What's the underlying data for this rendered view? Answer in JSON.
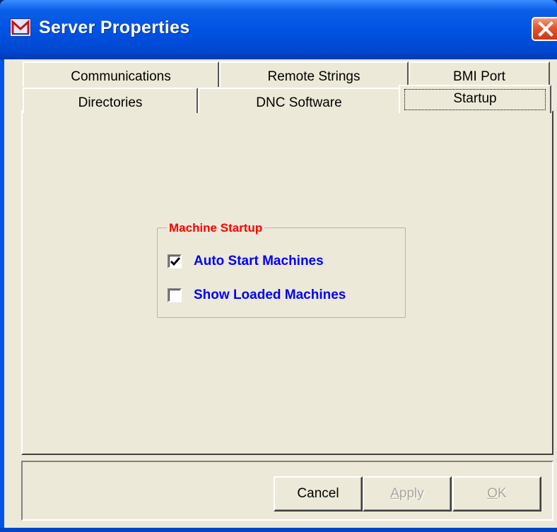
{
  "window": {
    "title": "Server Properties",
    "close_glyph": "✕",
    "icon": "app-logo-icon",
    "colors": {
      "titlebar": "#0054e3",
      "close": "#e0552d",
      "face": "#ece9d8"
    }
  },
  "tabs": {
    "back_row": [
      {
        "label": "Communications"
      },
      {
        "label": "Remote Strings"
      },
      {
        "label": "BMI Port"
      }
    ],
    "front_row": [
      {
        "label": "Directories"
      },
      {
        "label": "DNC Software"
      },
      {
        "label": "Startup",
        "selected": true
      }
    ]
  },
  "startup": {
    "group_title": "Machine Startup",
    "group_title_color": "#ff0000",
    "label_color": "#0000ff",
    "options": [
      {
        "label": "Auto Start Machines",
        "checked": true
      },
      {
        "label": "Show Loaded Machines",
        "checked": false
      }
    ]
  },
  "buttons": {
    "cancel": {
      "label": "Cancel",
      "enabled": true
    },
    "apply": {
      "label": "Apply",
      "mnemonic": "A",
      "rest": "pply",
      "enabled": false
    },
    "ok": {
      "label": "OK",
      "mnemonic": "O",
      "rest": "K",
      "enabled": false
    }
  }
}
